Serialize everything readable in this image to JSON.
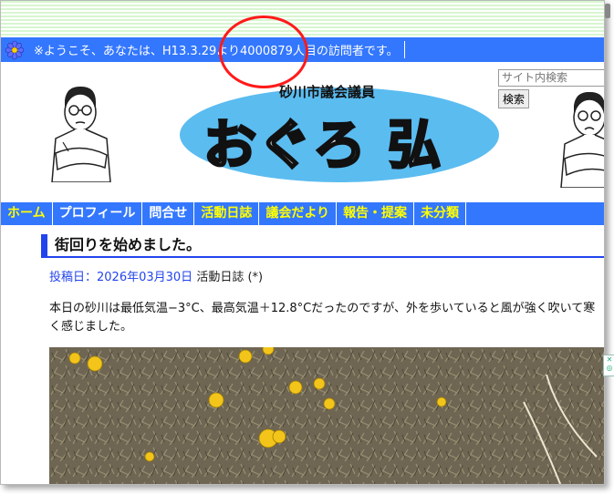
{
  "visitor_bar": {
    "text": "※ようこそ、あなたは、H13.3.29より4000879人目の訪問者です。"
  },
  "header": {
    "subtitle": "砂川市議会議員",
    "logo_text": "おぐろ 弘"
  },
  "search": {
    "placeholder": "サイト内検索",
    "button_label": "検索"
  },
  "nav": {
    "items": [
      {
        "label": "ホーム",
        "color": "#ffff00"
      },
      {
        "label": "プロフィール",
        "color": "#ffffff"
      },
      {
        "label": "問合せ",
        "color": "#ffffff"
      },
      {
        "label": "活動日誌",
        "color": "#ffff00"
      },
      {
        "label": "議会だより",
        "color": "#ffff00"
      },
      {
        "label": "報告・提案",
        "color": "#ffff00"
      },
      {
        "label": "未分類",
        "color": "#ffff00"
      }
    ]
  },
  "post": {
    "title": "街回りを始めました。",
    "date_label": "投稿日：2026年03月30日",
    "category": "活動日誌",
    "suffix": "(*)",
    "body": "本日の砂川は最低気温−3°C、最高気温＋12.8°Cだったのですが、外を歩いていると風が強く吹いて寒く感じました。"
  },
  "colors": {
    "accent_blue": "#3377ff",
    "highlight_circle": "#ff1a1a",
    "logo_fill": "#5bbcf0"
  }
}
